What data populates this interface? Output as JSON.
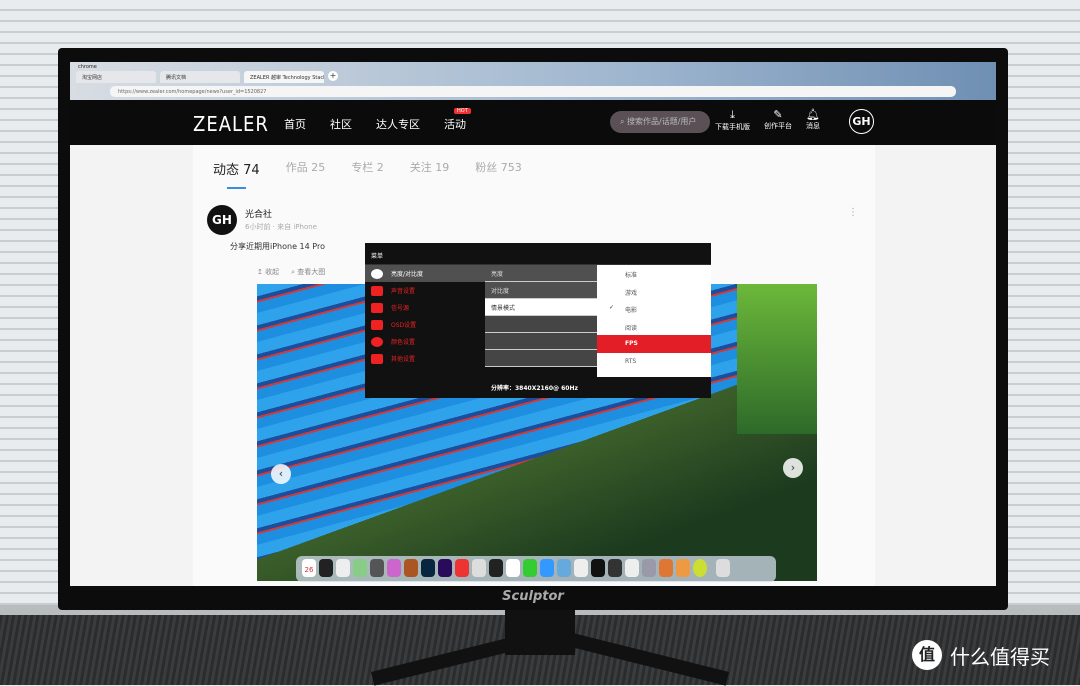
{
  "browser": {
    "app_menu": "chrome",
    "tabs": [
      "淘宝网店",
      "腾讯文档",
      "ZEALER 越审 Technology Stack"
    ],
    "url": "https://www.zealer.com/homepage/news?user_id=1520827"
  },
  "header": {
    "logo": "ZEALER",
    "nav": [
      "首页",
      "社区",
      "达人专区",
      "活动"
    ],
    "hot_badge": "HOT",
    "search_placeholder": "搜索作品/话题/用户",
    "actions": [
      {
        "icon": "download-icon",
        "label": "下载手机版"
      },
      {
        "icon": "edit-icon",
        "label": "创作平台"
      },
      {
        "icon": "bell-icon",
        "label": "消息"
      }
    ],
    "avatar": "GH"
  },
  "profile_tabs": [
    {
      "label": "动态",
      "count": "74"
    },
    {
      "label": "作品",
      "count": "25"
    },
    {
      "label": "专栏",
      "count": "2"
    },
    {
      "label": "关注",
      "count": "19"
    },
    {
      "label": "粉丝",
      "count": "753"
    }
  ],
  "post": {
    "avatar": "GH",
    "author": "光合社",
    "meta": "6小时前 · 来自 iPhone",
    "text": "分享近期用iPhone 14 Pro",
    "actions": [
      "收起",
      "查看大图"
    ]
  },
  "osd": {
    "title": "菜单",
    "categories": [
      "亮度/对比度",
      "声音设置",
      "信号源",
      "OSD设置",
      "颜色设置",
      "其他设置"
    ],
    "settings": [
      "亮度",
      "对比度",
      "情景模式"
    ],
    "modes": [
      "标准",
      "游戏",
      "电影",
      "阅读",
      "FPS",
      "RTS"
    ],
    "checked_mode": "电影",
    "highlighted_mode": "FPS",
    "resolution": "分辨率：3840X2160@ 60Hz",
    "accent": "#e41e26"
  },
  "dock": {
    "calendar_day": "26"
  },
  "monitor": {
    "brand": "Sculptor"
  },
  "watermark": {
    "logo": "值",
    "text": "什么值得买"
  }
}
